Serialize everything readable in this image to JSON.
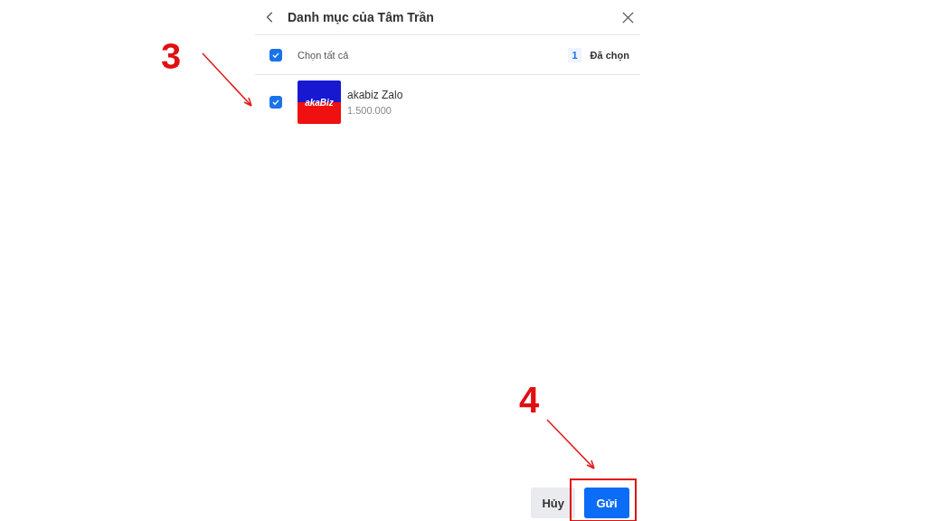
{
  "header": {
    "title": "Danh mục của Tâm Trần"
  },
  "select_all": {
    "label": "Chọn tất cả",
    "checked": true,
    "count": "1",
    "count_label": "Đã chọn"
  },
  "items": [
    {
      "logo_text": "akaBiz",
      "name": "akabiz Zalo",
      "price": "1.500.000",
      "checked": true
    }
  ],
  "footer": {
    "cancel": "Hủy",
    "submit": "Gửi"
  },
  "annotations": [
    {
      "label": "3"
    },
    {
      "label": "4"
    }
  ]
}
